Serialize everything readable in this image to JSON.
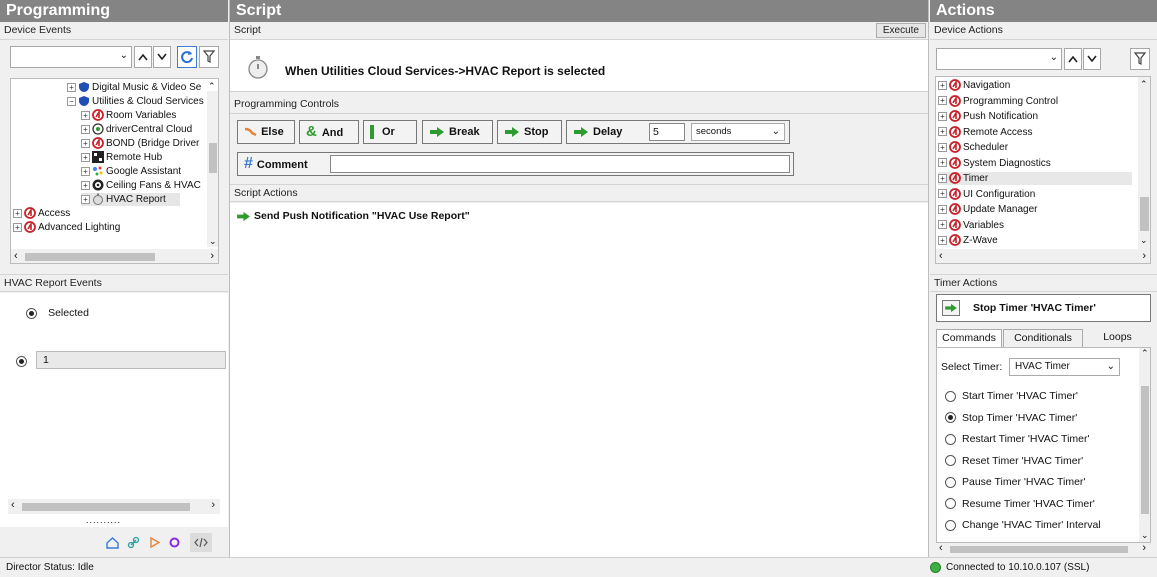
{
  "programming": {
    "title": "Programming",
    "device_events_label": "Device Events",
    "tree": [
      {
        "label": "Digital Music & Video Se",
        "icon": "shield-icon"
      },
      {
        "label": "Utilities & Cloud Services",
        "icon": "shield-icon"
      },
      {
        "label": "Room Variables",
        "icon": "control4-icon"
      },
      {
        "label": "driverCentral Cloud",
        "icon": "cloud-driver-icon"
      },
      {
        "label": "BOND (Bridge Driver",
        "icon": "control4-icon"
      },
      {
        "label": "Remote Hub",
        "icon": "hub-icon"
      },
      {
        "label": "Google Assistant",
        "icon": "google-assistant-icon"
      },
      {
        "label": "Ceiling Fans & HVAC",
        "icon": "fan-icon"
      },
      {
        "label": "HVAC Report",
        "icon": "stopwatch-icon"
      },
      {
        "label": "Access",
        "icon": "control4-icon"
      },
      {
        "label": "Advanced Lighting",
        "icon": "control4-icon"
      }
    ],
    "events_label": "HVAC Report Events",
    "selected_label": "Selected",
    "value_field": "1",
    "dots": "..........",
    "footer_icons": [
      "home-icon",
      "link-icon",
      "play-icon",
      "component-icon",
      "code-icon"
    ]
  },
  "script": {
    "title": "Script",
    "script_label": "Script",
    "execute_label": "Execute",
    "event_title": "When Utilities  Cloud Services->HVAC Report is selected",
    "controls_label": "Programming Controls",
    "buttons": {
      "else": "Else",
      "and": "And",
      "or": "Or",
      "break": "Break",
      "stop": "Stop",
      "delay": "Delay"
    },
    "delay_value": "5",
    "delay_unit": "seconds",
    "comment_label": "Comment",
    "actions_label": "Script Actions",
    "action_item": "Send Push Notification \"HVAC Use Report\""
  },
  "actions": {
    "title": "Actions",
    "device_actions_label": "Device Actions",
    "tree": [
      "Navigation",
      "Programming Control",
      "Push Notification",
      "Remote Access",
      "Scheduler",
      "System Diagnostics",
      "Timer",
      "UI Configuration",
      "Update Manager",
      "Variables",
      "Z-Wave"
    ],
    "selected_tree_item": "Timer",
    "timer_actions_label": "Timer Actions",
    "drag_action": "Stop Timer 'HVAC Timer'",
    "tabs": [
      "Commands",
      "Conditionals",
      "Loops"
    ],
    "active_tab": "Commands",
    "select_timer_label": "Select Timer:",
    "select_timer_value": "HVAC Timer",
    "commands": [
      {
        "label": "Start Timer 'HVAC Timer'",
        "checked": false
      },
      {
        "label": "Stop Timer 'HVAC Timer'",
        "checked": true
      },
      {
        "label": "Restart Timer 'HVAC Timer'",
        "checked": false
      },
      {
        "label": "Reset Timer 'HVAC Timer'",
        "checked": false
      },
      {
        "label": "Pause Timer 'HVAC Timer'",
        "checked": false
      },
      {
        "label": "Resume Timer 'HVAC Timer'",
        "checked": false
      },
      {
        "label": "Change 'HVAC Timer' Interval",
        "checked": false
      }
    ]
  },
  "status": {
    "director": "Director Status: Idle",
    "connection": "Connected to 10.10.0.107 (SSL)"
  },
  "colors": {
    "header": "#848484",
    "green_arrow": "#2e9b2e",
    "c4_red": "#c8202a",
    "shield_blue": "#1f4fb5",
    "connected_green": "#3cb043"
  }
}
